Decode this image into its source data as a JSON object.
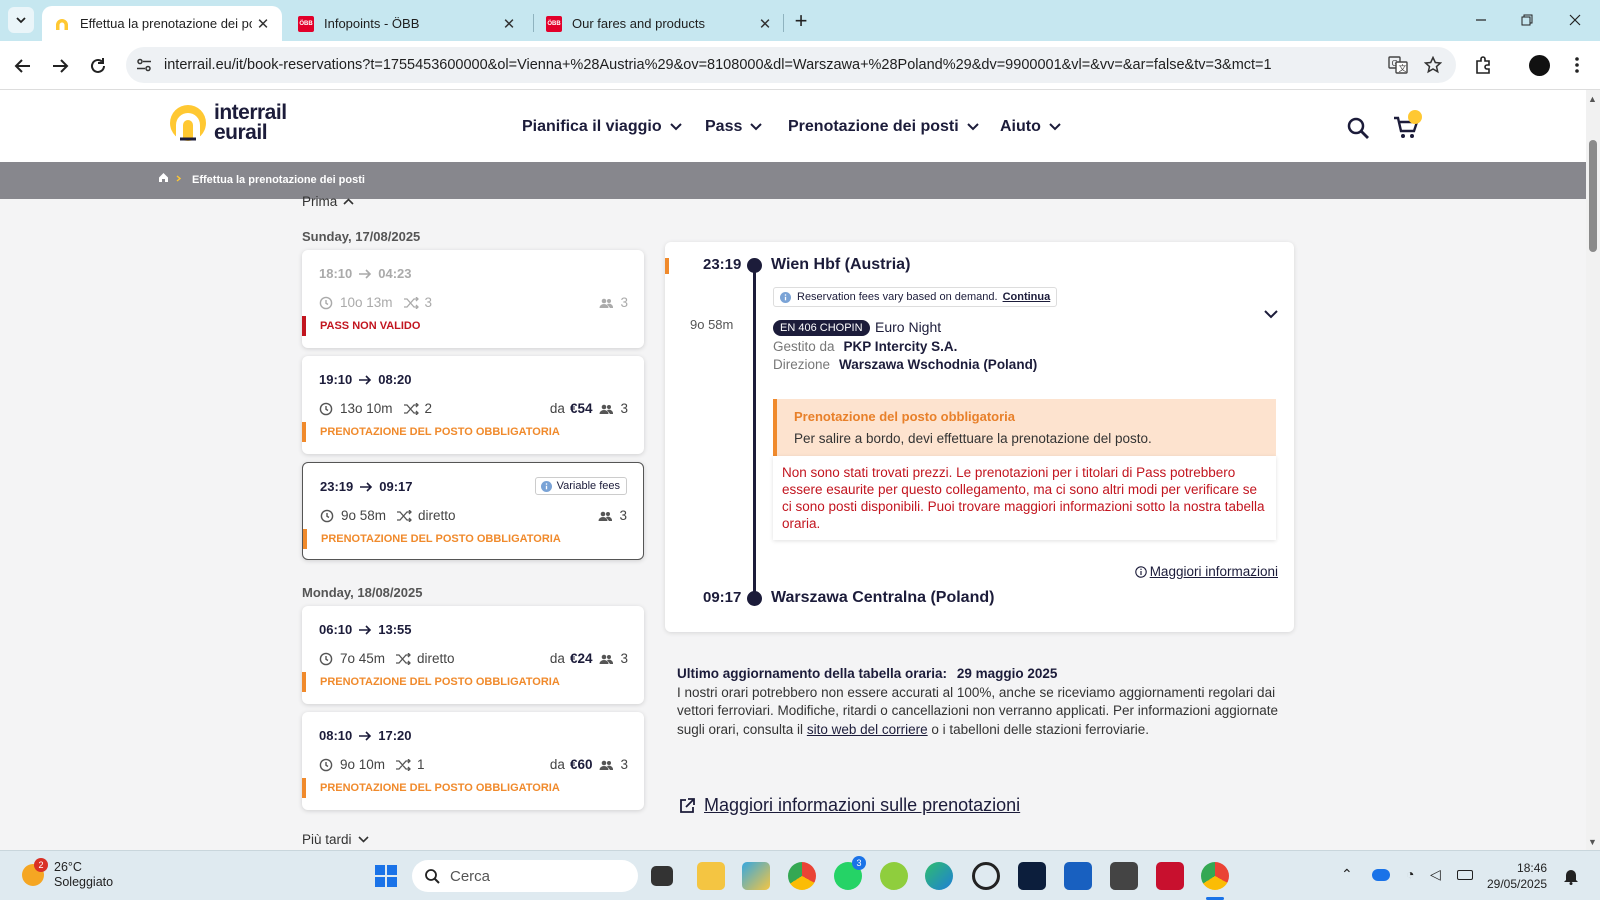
{
  "browser": {
    "tabs": [
      {
        "title": "Effettua la prenotazione dei pos",
        "active": true,
        "favicon": "interrail-icon"
      },
      {
        "title": "Infopoints - ÖBB",
        "active": false,
        "favicon": "obb-icon"
      },
      {
        "title": "Our fares and products",
        "active": false,
        "favicon": "obb-icon"
      }
    ],
    "obb_favicon_text": "ÖBB",
    "url": "interrail.eu/it/book-reservations?t=1755453600000&ol=Vienna+%28Austria%29&ov=8108000&dl=Warszawa+%28Poland%29&dv=9900001&vl=&vv=&ar=false&tv=3&mct=1"
  },
  "site": {
    "logo_line1": "interrail",
    "logo_line2": "eurail",
    "nav": [
      "Pianifica il viaggio",
      "Pass",
      "Prenotazione dei posti",
      "Aiuto"
    ],
    "breadcrumb": "Effettua la prenotazione dei posti"
  },
  "results": {
    "earlier_label": "Prima",
    "later_label": "Più tardi",
    "days": [
      {
        "label": "Sunday, 17/08/2025",
        "connections": [
          {
            "dep": "18:10",
            "arr": "04:23",
            "duration": "10o 13m",
            "changes": "3",
            "price_prefix": "",
            "price": "",
            "passengers": "3",
            "status": "PASS NON VALIDO"
          },
          {
            "dep": "19:10",
            "arr": "08:20",
            "duration": "13o 10m",
            "changes": "2",
            "price_prefix": "da",
            "price": "€54",
            "passengers": "3",
            "status": "PRENOTAZIONE DEL POSTO OBBLIGATORIA"
          },
          {
            "dep": "23:19",
            "arr": "09:17",
            "duration": "9o 58m",
            "changes": "diretto",
            "price_prefix": "",
            "price": "",
            "passengers": "3",
            "status": "PRENOTAZIONE DEL POSTO OBBLIGATORIA",
            "badge": "Variable fees",
            "selected": true
          }
        ]
      },
      {
        "label": "Monday, 18/08/2025",
        "connections": [
          {
            "dep": "06:10",
            "arr": "13:55",
            "duration": "7o 45m",
            "changes": "diretto",
            "price_prefix": "da",
            "price": "€24",
            "passengers": "3",
            "status": "PRENOTAZIONE DEL POSTO OBBLIGATORIA"
          },
          {
            "dep": "08:10",
            "arr": "17:20",
            "duration": "9o 10m",
            "changes": "1",
            "price_prefix": "da",
            "price": "€60",
            "passengers": "3",
            "status": "PRENOTAZIONE DEL POSTO OBBLIGATORIA"
          }
        ]
      }
    ]
  },
  "detail": {
    "dep_time": "23:19",
    "dep_station": "Wien Hbf (Austria)",
    "fee_note": "Reservation fees vary based on demand.",
    "fee_link": "Continua",
    "duration": "9o 58m",
    "train_badge": "EN 406 CHOPIN",
    "train_type": "Euro Night",
    "operator_label": "Gestito da",
    "operator": "PKP Intercity S.A.",
    "direction_label": "Direzione",
    "direction": "Warszawa Wschodnia (Poland)",
    "warning_title": "Prenotazione del posto obbligatoria",
    "warning_text": "Per salire a bordo, devi effettuare la prenotazione del posto.",
    "error_text": "Non sono stati trovati prezzi. Le prenotazioni per i titolari di Pass potrebbero essere esaurite per questo collegamento, ma ci sono altri modi per verificare se ci sono posti disponibili. Puoi trovare maggiori informazioni sotto la nostra tabella oraria.",
    "more_info": "Maggiori informazioni",
    "arr_time": "09:17",
    "arr_station": "Warszawa Centralna (Poland)"
  },
  "timetable_note": {
    "label": "Ultimo aggiornamento della tabella oraria:",
    "date": "29 maggio 2025",
    "text_before": "I nostri orari potrebbero non essere accurati al 100%, anche se riceviamo aggiornamenti regolari dai vettori ferroviari. Modifiche, ritardi o cancellazioni non verranno applicati. Per informazioni aggiornate sugli orari, consulta il",
    "link": "sito web del corriere",
    "text_after": "o i tabelloni delle stazioni ferroviarie."
  },
  "booking_info_link": "Maggiori informazioni sulle prenotazioni",
  "taskbar": {
    "weather_badge": "2",
    "temperature": "26°C",
    "condition": "Soleggiato",
    "search_placeholder": "Cerca",
    "whatsapp_badge": "3",
    "time": "18:46",
    "date": "29/05/2025"
  },
  "colors": {
    "accent": "#f08a2c",
    "navy": "#1c1c3a",
    "error": "#c2151f",
    "yellow": "#ffc832"
  }
}
